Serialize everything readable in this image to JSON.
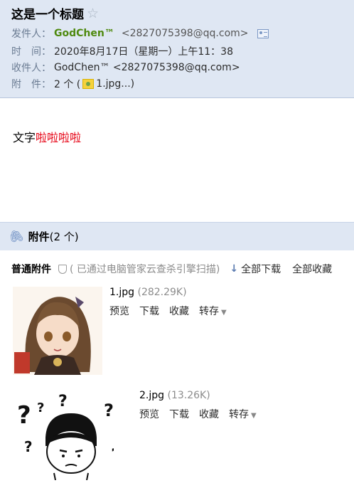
{
  "header": {
    "subject": "这是一个标题",
    "star": "☆",
    "from_label": "发件人：",
    "from_name": "GodChen™",
    "from_addr": "<2827075398@qq.com>",
    "time_label": "时　间：",
    "time_value": "2020年8月17日（星期一）上午11：38",
    "to_label": "收件人：",
    "to_value": "GodChen™ <2827075398@qq.com>",
    "att_label": "附　件：",
    "att_count_prefix": "2 个 (",
    "att_first": "1.jpg...)"
  },
  "body": {
    "plain": "文字",
    "red": "啦啦啦啦"
  },
  "attachments": {
    "title": "附件",
    "count": "(2 个)",
    "normal_label": "普通附件",
    "scan_note": "(  已通过电脑管家云查杀引擎扫描)",
    "download_all": "全部下载",
    "favorite_all": "全部收藏",
    "items": [
      {
        "name": "1.jpg",
        "size": "(282.29K)",
        "preview": "预览",
        "download": "下载",
        "favorite": "收藏",
        "transfer": "转存"
      },
      {
        "name": "2.jpg",
        "size": "(13.26K)",
        "preview": "预览",
        "download": "下载",
        "favorite": "收藏",
        "transfer": "转存"
      }
    ]
  },
  "colors": {
    "header_bg": "#dfe7f3",
    "sender_green": "#4f8a10",
    "body_red": "#e60012"
  }
}
